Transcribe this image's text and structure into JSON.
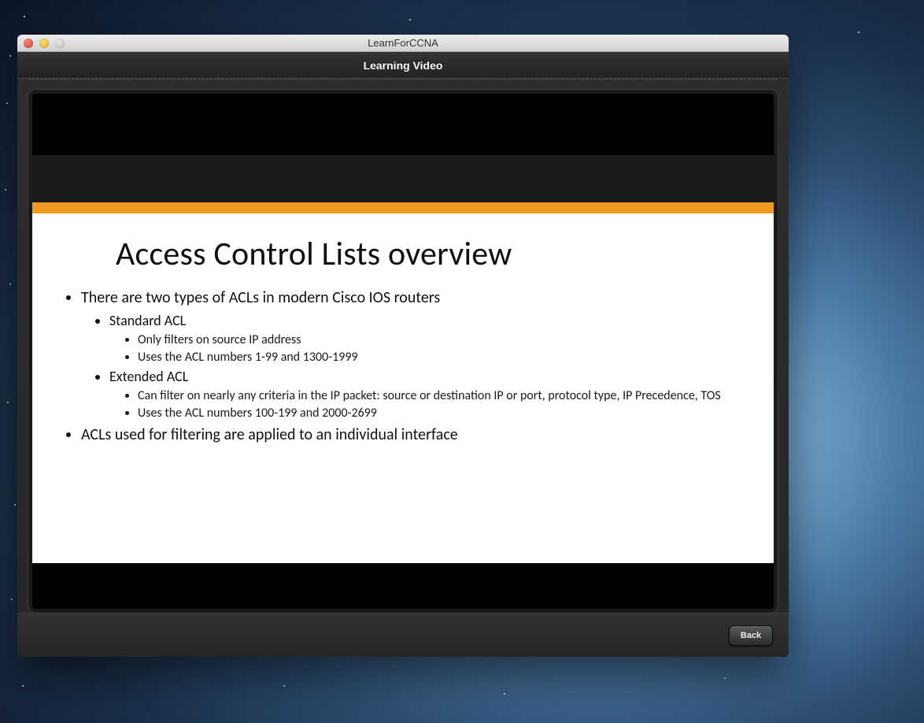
{
  "window": {
    "title": "LearnForCCNA",
    "subtitle": "Learning Video"
  },
  "footer": {
    "back_label": "Back"
  },
  "slide": {
    "title": "Access Control Lists overview",
    "bullets_top": [
      "There are two types of ACLs in modern Cisco IOS routers",
      "ACLs used for filtering are applied to an individual interface"
    ],
    "standard": {
      "label": "Standard ACL",
      "points": [
        "Only filters on source IP address",
        "Uses the ACL numbers 1-99 and 1300-1999"
      ]
    },
    "extended": {
      "label": "Extended ACL",
      "points": [
        "Can filter on nearly any criteria in the IP packet: source or destination IP or port, protocol type, IP Precedence, TOS",
        "Uses the ACL numbers 100-199 and 2000-2699"
      ]
    }
  }
}
